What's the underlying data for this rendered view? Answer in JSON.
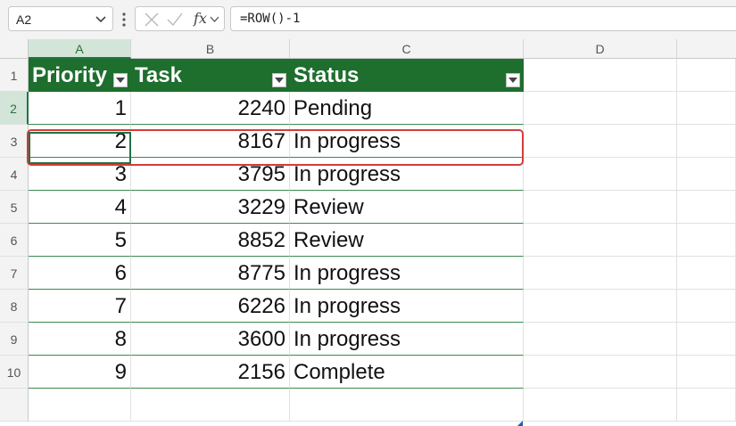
{
  "name_box": {
    "value": "A2"
  },
  "formula_bar": {
    "value": "=ROW()-1",
    "fx_label": "fx"
  },
  "columns": [
    "A",
    "B",
    "C",
    "D"
  ],
  "rows": [
    "1",
    "2",
    "3",
    "4",
    "5",
    "6",
    "7",
    "8",
    "9",
    "10"
  ],
  "selected": {
    "column": "A",
    "row": "2"
  },
  "table": {
    "headers": [
      "Priority",
      "Task",
      "Status"
    ],
    "rows": [
      [
        "1",
        "2240",
        "Pending"
      ],
      [
        "2",
        "8167",
        "In progress"
      ],
      [
        "3",
        "3795",
        "In progress"
      ],
      [
        "4",
        "3229",
        "Review"
      ],
      [
        "5",
        "8852",
        "Review"
      ],
      [
        "6",
        "8775",
        "In progress"
      ],
      [
        "7",
        "6226",
        "In progress"
      ],
      [
        "8",
        "3600",
        "In progress"
      ],
      [
        "9",
        "2156",
        "Complete"
      ]
    ]
  },
  "colors": {
    "header_fill": "#1e6e2e",
    "selection": "#217346",
    "highlight": "#d63b3b"
  }
}
